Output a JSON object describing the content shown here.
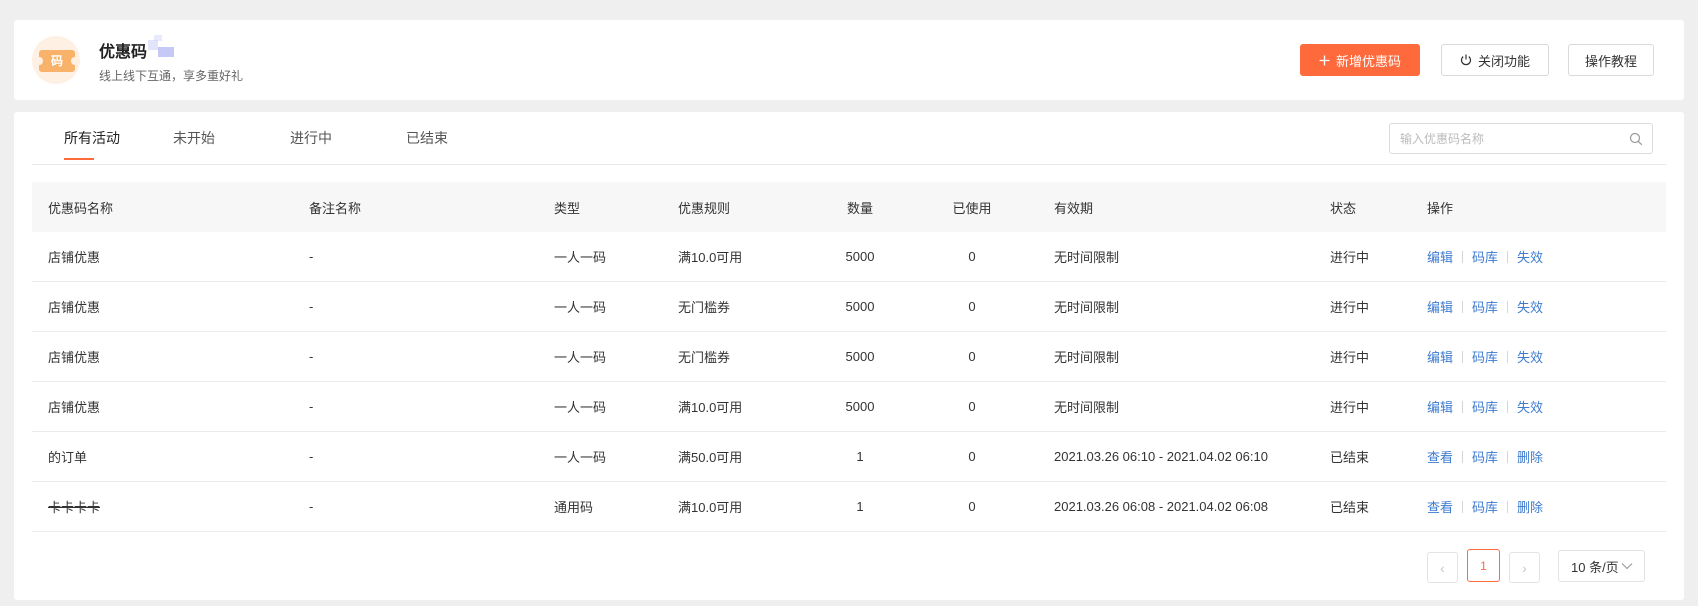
{
  "header": {
    "logo_text": "码",
    "title": "优惠码",
    "subtitle": "线上线下互通，享多重好礼",
    "add_button": "新增优惠码",
    "close_button": "关闭功能",
    "tutorial_button": "操作教程"
  },
  "tabs": [
    {
      "label": "所有活动",
      "active": true
    },
    {
      "label": "未开始",
      "active": false
    },
    {
      "label": "进行中",
      "active": false
    },
    {
      "label": "已结束",
      "active": false
    }
  ],
  "search": {
    "placeholder": "输入优惠码名称",
    "value": ""
  },
  "table": {
    "columns": [
      "优惠码名称",
      "备注名称",
      "类型",
      "优惠规则",
      "数量",
      "已使用",
      "有效期",
      "状态",
      "操作"
    ],
    "rows": [
      {
        "name": "店铺优惠",
        "note": "-",
        "type": "一人一码",
        "rule": "满10.0可用",
        "qty": "5000",
        "used": "0",
        "validity": "无时间限制",
        "status": "进行中",
        "ops": [
          "编辑",
          "码库",
          "失效"
        ]
      },
      {
        "name": "店铺优惠",
        "note": "-",
        "type": "一人一码",
        "rule": "无门槛券",
        "qty": "5000",
        "used": "0",
        "validity": "无时间限制",
        "status": "进行中",
        "ops": [
          "编辑",
          "码库",
          "失效"
        ]
      },
      {
        "name": "店铺优惠",
        "note": "-",
        "type": "一人一码",
        "rule": "无门槛券",
        "qty": "5000",
        "used": "0",
        "validity": "无时间限制",
        "status": "进行中",
        "ops": [
          "编辑",
          "码库",
          "失效"
        ]
      },
      {
        "name": "店铺优惠",
        "note": "-",
        "type": "一人一码",
        "rule": "满10.0可用",
        "qty": "5000",
        "used": "0",
        "validity": "无时间限制",
        "status": "进行中",
        "ops": [
          "编辑",
          "码库",
          "失效"
        ]
      },
      {
        "name": "的订单",
        "note": "-",
        "type": "一人一码",
        "rule": "满50.0可用",
        "qty": "1",
        "used": "0",
        "validity": "2021.03.26 06:10 - 2021.04.02 06:10",
        "status": "已结束",
        "ops": [
          "查看",
          "码库",
          "删除"
        ]
      },
      {
        "name": "卡卡卡卡",
        "note": "-",
        "type": "通用码",
        "rule": "满10.0可用",
        "qty": "1",
        "used": "0",
        "validity": "2021.03.26 06:08 - 2021.04.02 06:08",
        "status": "已结束",
        "ops": [
          "查看",
          "码库",
          "删除"
        ]
      }
    ]
  },
  "pagination": {
    "prev": "‹",
    "current_page": "1",
    "next": "›",
    "page_size": "10 条/页"
  },
  "colors": {
    "accent": "#ff6a3d",
    "link": "#3d7bd0"
  }
}
